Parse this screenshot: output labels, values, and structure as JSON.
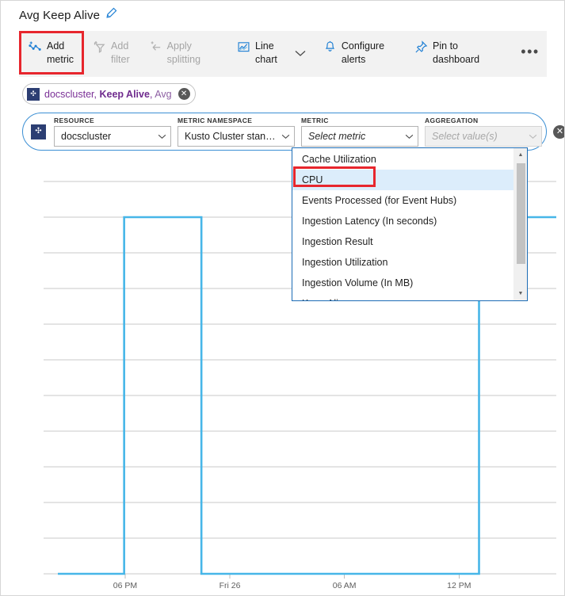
{
  "header": {
    "title": "Avg Keep Alive",
    "edit_icon": "pencil-icon"
  },
  "toolbar": {
    "buttons": [
      {
        "label": "Add\nmetric",
        "icon": "add-metric-icon",
        "disabled": false,
        "highlighted": true
      },
      {
        "label": "Add\nfilter",
        "icon": "add-filter-icon",
        "disabled": true,
        "highlighted": false
      },
      {
        "label": "Apply\nsplitting",
        "icon": "apply-splitting-icon",
        "disabled": true,
        "highlighted": false
      },
      {
        "label": "Line\nchart",
        "icon": "line-chart-icon",
        "disabled": false,
        "highlighted": false
      },
      {
        "label": "Configure\nalerts",
        "icon": "bell-icon",
        "disabled": false,
        "highlighted": false
      },
      {
        "label": "Pin to\ndashboard",
        "icon": "pin-icon",
        "disabled": false,
        "highlighted": false
      }
    ],
    "chevron_icon": "chevron-down-icon",
    "more_label": "•••",
    "more_icon": "ellipsis-icon"
  },
  "chip": {
    "resource": "docscluster",
    "separator1": ", ",
    "metric": "Keep Alive",
    "separator2": ", ",
    "aggregation": "Avg",
    "close_icon": "close-icon",
    "close_label": "✕"
  },
  "selector": {
    "fields": [
      {
        "label": "RESOURCE",
        "value": "docscluster",
        "placeholder": "",
        "disabled": false,
        "italic": false
      },
      {
        "label": "METRIC NAMESPACE",
        "value": "Kusto Cluster stand...",
        "placeholder": "",
        "disabled": false,
        "italic": false
      },
      {
        "label": "METRIC",
        "value": "Select metric",
        "placeholder": "Select metric",
        "disabled": false,
        "italic": true
      },
      {
        "label": "AGGREGATION",
        "value": "Select value(s)",
        "placeholder": "Select value(s)",
        "disabled": true,
        "italic": true
      }
    ],
    "remove_label": "✕",
    "remove_icon": "close-icon"
  },
  "dropdown": {
    "options": [
      {
        "label": "Cache Utilization",
        "selected": false
      },
      {
        "label": "CPU",
        "selected": true
      },
      {
        "label": "Events Processed (for Event Hubs)",
        "selected": false
      },
      {
        "label": "Ingestion Latency (In seconds)",
        "selected": false
      },
      {
        "label": "Ingestion Result",
        "selected": false
      },
      {
        "label": "Ingestion Utilization",
        "selected": false
      },
      {
        "label": "Ingestion Volume (In MB)",
        "selected": false
      },
      {
        "label": "Keep Alive",
        "selected": false
      }
    ],
    "scroll_up_icon": "scroll-up-arrow-icon",
    "scroll_down_icon": "scroll-down-arrow-icon",
    "scroll_up_label": "▲",
    "scroll_down_label": "▼"
  },
  "colors": {
    "accent": "#0078d4",
    "highlight": "#e7262d",
    "series": "#47b6e8",
    "chip_text": "#7a2f96",
    "grid": "#c8c8c8"
  },
  "chart_data": {
    "type": "line",
    "title": "Avg Keep Alive",
    "xlabel": "",
    "ylabel": "",
    "ylim": [
      0,
      1.1
    ],
    "grid": true,
    "legend": "none",
    "yticks": [
      "0",
      "0.10",
      "0.20",
      "0.30",
      "0.40",
      "0.50",
      "0.60",
      "0.70",
      "0.80",
      "0.90",
      "1",
      "1.10"
    ],
    "ytick_values": [
      0,
      0.1,
      0.2,
      0.3,
      0.4,
      0.5,
      0.6,
      0.7,
      0.8,
      0.9,
      1,
      1.1
    ],
    "xticks": [
      "06 PM",
      "Fri 26",
      "06 AM",
      "12 PM"
    ],
    "xtick_positions": [
      0.135,
      0.345,
      0.575,
      0.805
    ],
    "series": [
      {
        "name": "Avg Keep Alive",
        "color": "#47b6e8",
        "x": [
          0.0,
          0.133,
          0.133,
          0.288,
          0.288,
          0.845,
          0.845,
          1.0
        ],
        "values": [
          0,
          0,
          1,
          1,
          0,
          0,
          1,
          1
        ]
      }
    ]
  }
}
